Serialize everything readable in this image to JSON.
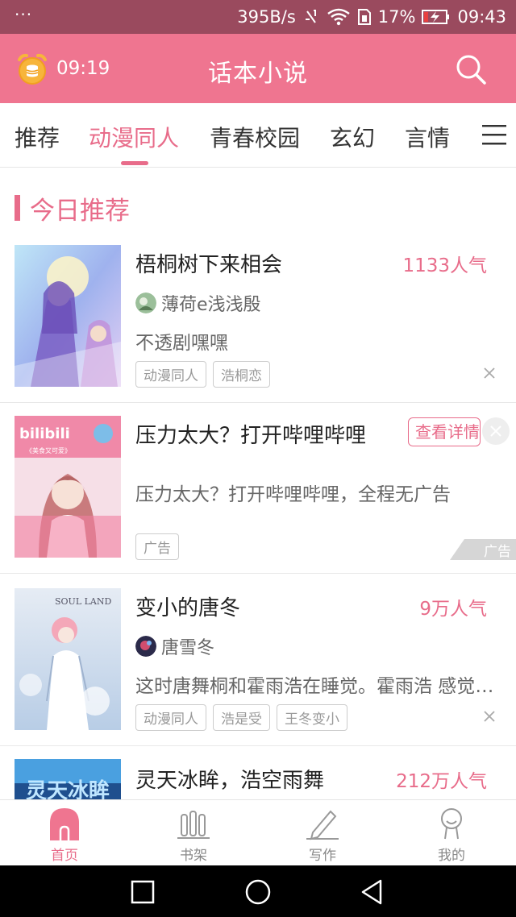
{
  "status_bar": {
    "dots": "···",
    "network_speed": "395B/s",
    "battery_percent": "17%",
    "clock": "09:43"
  },
  "header": {
    "time": "09:19",
    "title": "话本小说",
    "alarm_icon": "alarm-clock-icon",
    "search_icon": "search-icon",
    "color": "#ef7590"
  },
  "tabs": [
    {
      "label": "推荐",
      "active": false
    },
    {
      "label": "动漫同人",
      "active": true
    },
    {
      "label": "青春校园",
      "active": false
    },
    {
      "label": "玄幻",
      "active": false
    },
    {
      "label": "言情",
      "active": false
    }
  ],
  "section": {
    "title": "今日推荐"
  },
  "books": [
    {
      "title": "梧桐树下来相会",
      "popularity": "1133人气",
      "author": "薄荷e浅浅殷",
      "description": "不透剧嘿嘿",
      "tags": [
        "动漫同人",
        "浩桐恋"
      ]
    },
    {
      "title": "变小的唐冬",
      "popularity": "9万人气",
      "author": "唐雪冬",
      "description": "这时唐舞桐和霍雨浩在睡觉。霍雨浩 感觉到了什么",
      "cover_text": "SOUL LAND",
      "tags": [
        "动漫同人",
        "浩是受",
        "王冬变小"
      ]
    },
    {
      "title": "灵天冰眸，浩空雨舞",
      "popularity": "212万人气",
      "cover_text": "灵天冰眸"
    }
  ],
  "ad": {
    "title": "压力太大？打开哔哩哔哩",
    "button": "查看详情",
    "description": "压力太大？打开哔哩哔哩，全程无广告",
    "tag": "广告",
    "corner_label": "广告",
    "cover_logo": "bilibili",
    "cover_caption": "《美食又可爱》"
  },
  "bottom_nav": [
    {
      "label": "首页",
      "icon": "home-icon",
      "active": true
    },
    {
      "label": "书架",
      "icon": "bookshelf-icon",
      "active": false
    },
    {
      "label": "写作",
      "icon": "pen-icon",
      "active": false
    },
    {
      "label": "我的",
      "icon": "profile-icon",
      "active": false
    }
  ],
  "colors": {
    "accent": "#e86c8a",
    "status_bar": "#9a4a5e"
  }
}
